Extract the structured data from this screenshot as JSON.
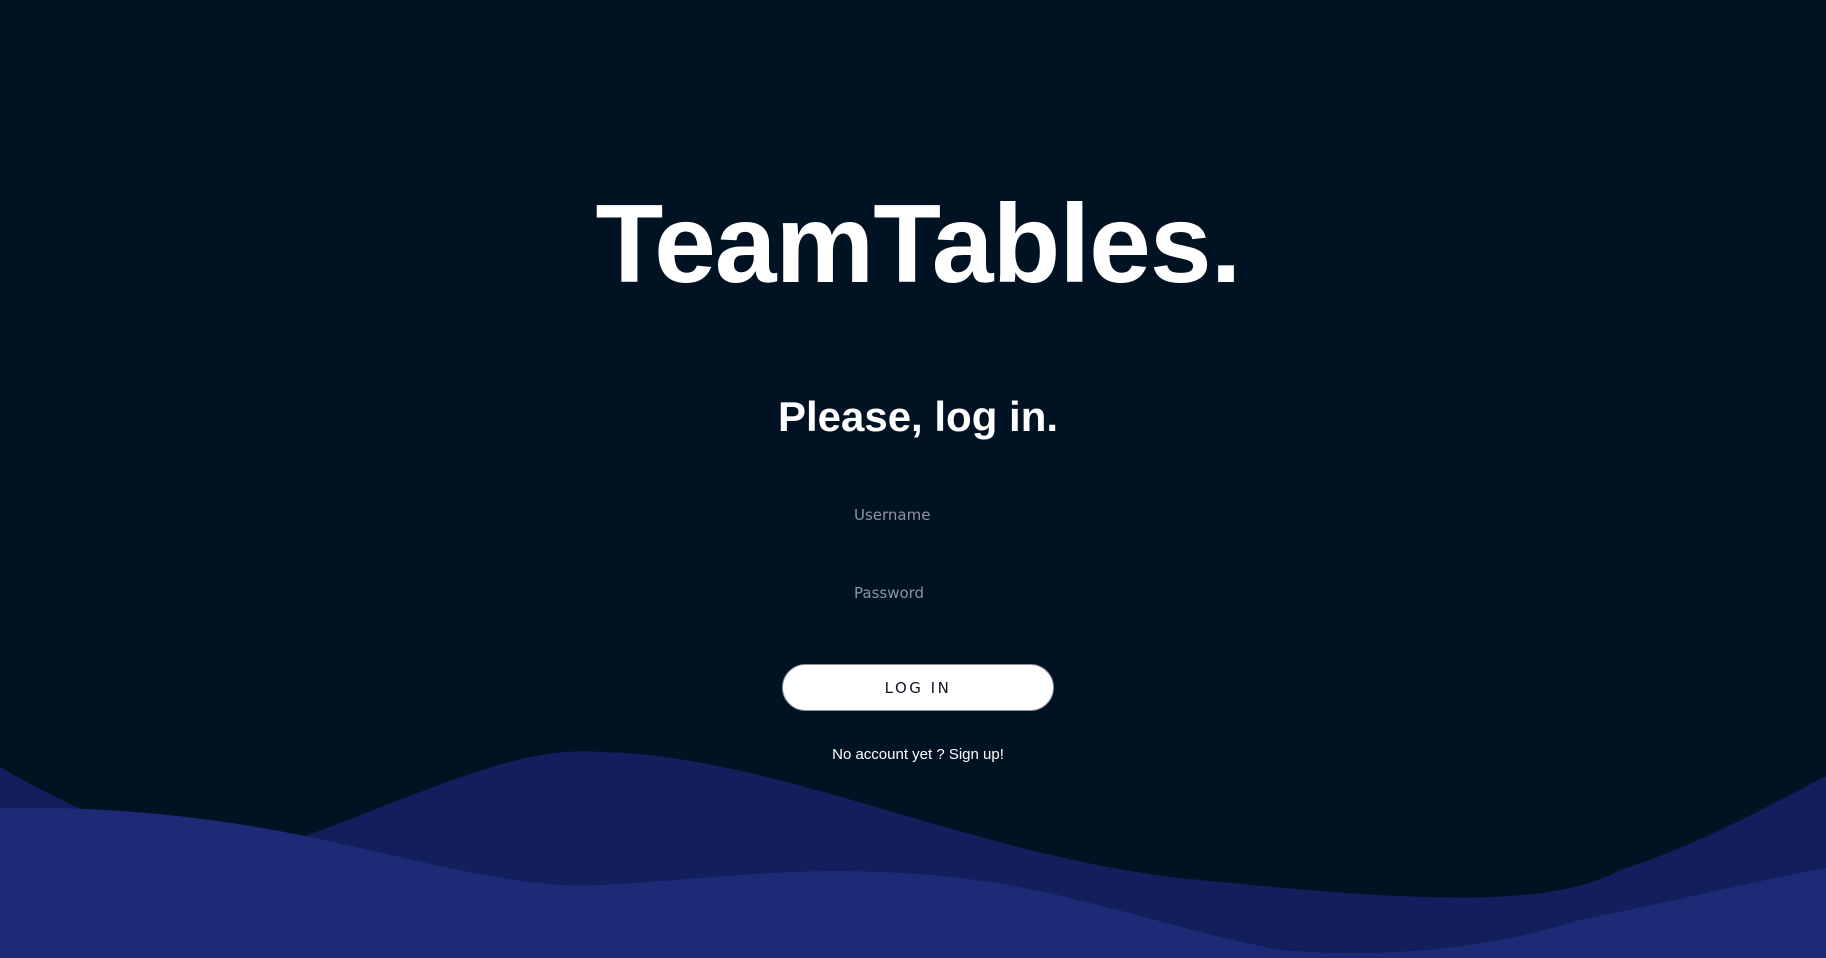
{
  "brand": {
    "title": "TeamTables."
  },
  "login": {
    "heading": "Please, log in.",
    "username_placeholder": "Username",
    "password_placeholder": "Password",
    "submit_label": "LOG IN",
    "signup_link": "No account yet ? Sign up!"
  },
  "colors": {
    "background": "#011222",
    "wave_back": "#121f5c",
    "wave_front": "#1e2a76",
    "button_background": "#ffffff",
    "text": "#ffffff"
  }
}
